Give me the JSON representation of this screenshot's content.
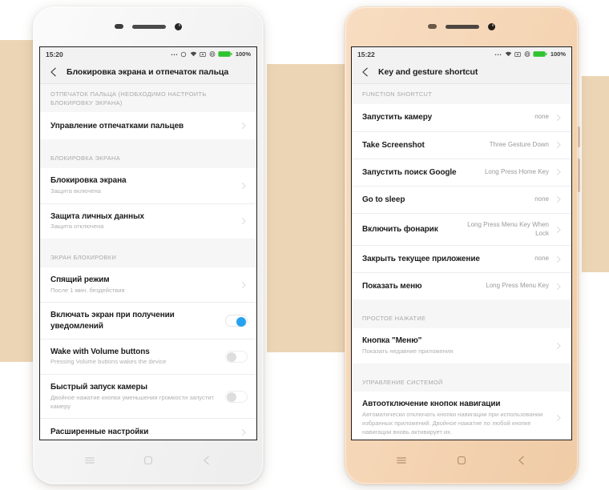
{
  "background": {
    "page_color": "#ffffff",
    "panel_color": "#ecd5b4"
  },
  "phone_left": {
    "frame_color": "#f4f4f4",
    "statusbar": {
      "time": "15:20",
      "icons": [
        "more-icon",
        "circle-icon",
        "wifi-icon",
        "sim-icon",
        "vibrate-icon",
        "battery-icon"
      ],
      "battery": "100%"
    },
    "titlebar": {
      "back_icon": "chevron-left-icon",
      "title": "Блокировка экрана и отпечаток пальца"
    },
    "sections": [
      {
        "header": "ОТПЕЧАТОК ПАЛЬЦА (НЕОБХОДИМО НАСТРОИТЬ БЛОКИРОВКУ ЭКРАНА)",
        "rows": [
          {
            "title": "Управление отпечатками пальцев",
            "sub": "",
            "value": "",
            "accessory": "chevron"
          }
        ]
      },
      {
        "header": "БЛОКИРОВКА ЭКРАНА",
        "rows": [
          {
            "title": "Блокировка экрана",
            "sub": "Защита включена",
            "value": "",
            "accessory": "chevron"
          },
          {
            "title": "Защита личных данных",
            "sub": "Защита отключена",
            "value": "",
            "accessory": "chevron"
          }
        ]
      },
      {
        "header": "ЭКРАН БЛОКИРОВКИ",
        "rows": [
          {
            "title": "Спящий режим",
            "sub": "После 1 мин. бездействия",
            "value": "",
            "accessory": "chevron"
          },
          {
            "title": "Включать экран при получении уведомлений",
            "sub": "",
            "value": "",
            "accessory": "toggle-on"
          },
          {
            "title": "Wake with Volume buttons",
            "sub": "Pressing Volume buttons wakes the device",
            "value": "",
            "accessory": "toggle-off"
          },
          {
            "title": "Быстрый запуск камеры",
            "sub": "Двойное нажатие кнопки уменьшения громкости запустит камеру",
            "value": "",
            "accessory": "toggle-off"
          },
          {
            "title": "Расширенные настройки",
            "sub": "",
            "value": "",
            "accessory": "chevron"
          }
        ]
      }
    ],
    "navbar": [
      "menu-icon",
      "home-icon",
      "back-icon"
    ]
  },
  "phone_right": {
    "frame_color": "#f5d6b6",
    "statusbar": {
      "time": "15:22",
      "icons": [
        "more-icon",
        "wifi-icon",
        "sim-icon",
        "vibrate-icon",
        "battery-icon"
      ],
      "battery": "100%"
    },
    "titlebar": {
      "back_icon": "chevron-left-icon",
      "title": "Key and gesture shortcut"
    },
    "sections": [
      {
        "header": "FUNCTION SHORTCUT",
        "rows": [
          {
            "title": "Запустить камеру",
            "sub": "",
            "value": "none",
            "accessory": "chevron"
          },
          {
            "title": "Take Screenshot",
            "sub": "",
            "value": "Three Gesture Down",
            "accessory": "chevron"
          },
          {
            "title": "Запустить поиск Google",
            "sub": "",
            "value": "Long Press Home Key",
            "accessory": "chevron"
          },
          {
            "title": "Go to sleep",
            "sub": "",
            "value": "none",
            "accessory": "chevron"
          },
          {
            "title": "Включить фонарик",
            "sub": "",
            "value": "Long Press Menu Key When Lock",
            "accessory": "chevron"
          },
          {
            "title": "Закрыть текущее приложение",
            "sub": "",
            "value": "none",
            "accessory": "chevron"
          },
          {
            "title": "Показать меню",
            "sub": "",
            "value": "Long Press Menu Key",
            "accessory": "chevron"
          }
        ]
      },
      {
        "header": "ПРОСТОЕ НАЖАТИЕ",
        "rows": [
          {
            "title": "Кнопка \"Меню\"",
            "sub": "Показать недавние приложения",
            "value": "",
            "accessory": "chevron"
          }
        ]
      },
      {
        "header": "УПРАВЛЕНИЕ СИСТЕМОЙ",
        "rows": [
          {
            "title": "Автоотключение кнопок навигации",
            "sub": "Автоматически отключать кнопки навигации при использовании избранных приложений. Двойное нажатие по любой кнопке навигации вновь активирует их.",
            "value": "",
            "accessory": "chevron"
          }
        ]
      }
    ],
    "navbar": [
      "menu-icon",
      "home-icon",
      "back-icon"
    ]
  }
}
